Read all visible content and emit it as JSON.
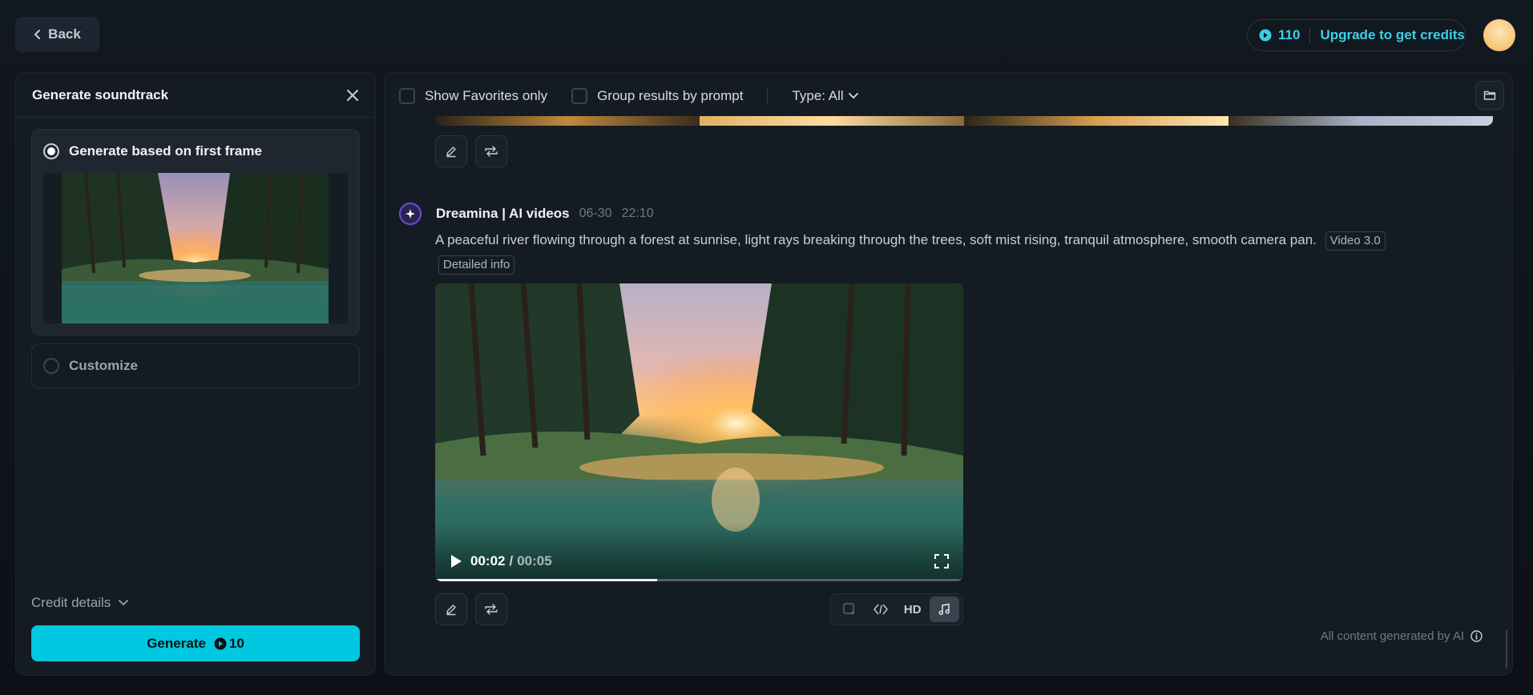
{
  "top": {
    "back_label": "Back",
    "credits": "110",
    "upgrade_label": "Upgrade to get credits"
  },
  "left_panel": {
    "title": "Generate soundtrack",
    "options": [
      {
        "label": "Generate based on first frame",
        "selected": true
      },
      {
        "label": "Customize",
        "selected": false
      }
    ],
    "credit_details_label": "Credit details",
    "generate_label": "Generate",
    "generate_cost": "10"
  },
  "right_panel": {
    "filters": {
      "favorites_label": "Show Favorites only",
      "group_label": "Group results by prompt",
      "type_label": "Type: All"
    },
    "generation": {
      "app_name": "Dreamina | AI videos",
      "date": "06-30",
      "time": "22:10",
      "prompt": "A peaceful river flowing through a forest at sunrise, light rays breaking through the trees, soft mist rising, tranquil atmosphere, smooth camera pan.",
      "model_tag": "Video 3.0",
      "detail_tag": "Detailed info",
      "video": {
        "current_time": "00:02",
        "separator": "/",
        "duration": "00:05",
        "progress": 0.42
      },
      "tools": [
        "extend-frame-icon",
        "interpolate-icon",
        "HD",
        "music-note-icon"
      ],
      "hd_label": "HD"
    },
    "footer_note": "All content generated by AI"
  },
  "colors": {
    "accent": "#00c8e0",
    "credits_text": "#39d1e8",
    "background": "#0d1117",
    "panel": "#151b23"
  }
}
